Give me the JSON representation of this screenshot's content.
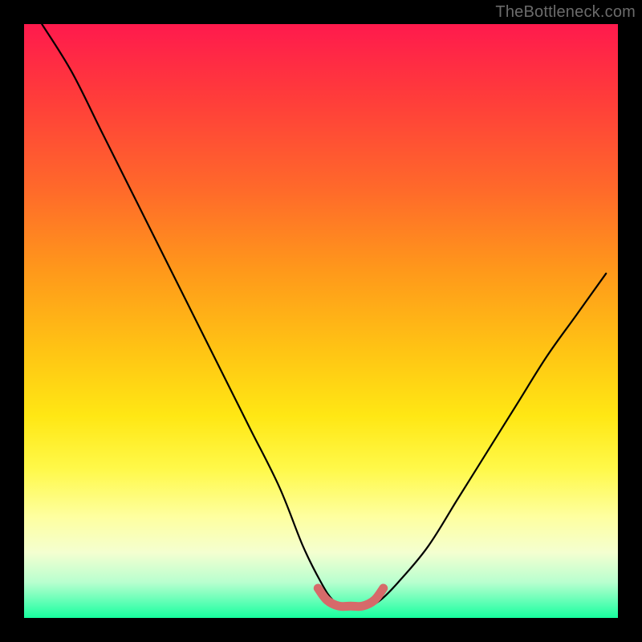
{
  "watermark": "TheBottleneck.com",
  "chart_data": {
    "type": "line",
    "title": "",
    "xlabel": "",
    "ylabel": "",
    "xlim": [
      0,
      100
    ],
    "ylim": [
      0,
      100
    ],
    "grid": false,
    "legend": false,
    "series": [
      {
        "name": "bottleneck-curve",
        "x": [
          3,
          8,
          13,
          18,
          23,
          28,
          33,
          38,
          43,
          47,
          50,
          52,
          54,
          56,
          58,
          60,
          63,
          68,
          73,
          78,
          83,
          88,
          93,
          98
        ],
        "y": [
          100,
          92,
          82,
          72,
          62,
          52,
          42,
          32,
          22,
          12,
          6,
          3,
          2,
          2,
          2,
          3,
          6,
          12,
          20,
          28,
          36,
          44,
          51,
          58
        ]
      },
      {
        "name": "optimal-range-marker",
        "x": [
          49.5,
          51,
          53,
          55,
          57,
          59,
          60.5
        ],
        "y": [
          5,
          3,
          2,
          2,
          2,
          3,
          5
        ]
      }
    ],
    "background": {
      "type": "vertical-gradient",
      "stops": [
        {
          "pos": 0,
          "color": "#ff1a4d"
        },
        {
          "pos": 50,
          "color": "#ffc414"
        },
        {
          "pos": 80,
          "color": "#feffa0"
        },
        {
          "pos": 100,
          "color": "#17ff9e"
        }
      ]
    }
  }
}
